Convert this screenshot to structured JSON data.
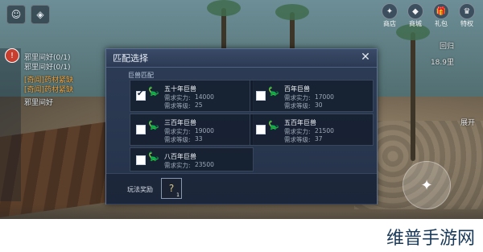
{
  "hud": {
    "top_right": [
      {
        "label": "商店",
        "icon": "shop-icon"
      },
      {
        "label": "商城",
        "icon": "mall-icon"
      },
      {
        "label": "礼包",
        "icon": "gift-icon"
      },
      {
        "label": "特权",
        "icon": "privilege-icon"
      }
    ],
    "left_quests": [
      {
        "text": "邪里间好(0/1)"
      },
      {
        "text": "邪里间好(0/1)"
      },
      {
        "text": "[奇闻]药材紧缺",
        "orange": true
      },
      {
        "text": "[奇闻]药材紧缺",
        "orange": true
      },
      {
        "text": "邪里间好"
      }
    ],
    "right_info": {
      "distance": "18.9里",
      "expand": "展开",
      "back": "回归"
    }
  },
  "dialog": {
    "title": "匹配选择",
    "section": "巨兽匹配",
    "options": [
      {
        "name": "五十年巨兽",
        "power_label": "需求实力:",
        "power": "14000",
        "level_label": "需求等级:",
        "level": "25",
        "checked": true
      },
      {
        "name": "百年巨兽",
        "power_label": "需求实力:",
        "power": "17000",
        "level_label": "需求等级:",
        "level": "30",
        "checked": false
      },
      {
        "name": "三百年巨兽",
        "power_label": "需求实力:",
        "power": "19000",
        "level_label": "需求等级:",
        "level": "33",
        "checked": false
      },
      {
        "name": "五百年巨兽",
        "power_label": "需求实力:",
        "power": "21500",
        "level_label": "需求等级:",
        "level": "37",
        "checked": false
      },
      {
        "name": "八百年巨兽",
        "power_label": "需求实力:",
        "power": "23500",
        "level_label": "",
        "level": "",
        "checked": false
      }
    ],
    "reward_label": "玩法奖励",
    "reward_item": {
      "icon": "question-item-icon",
      "count": "1"
    }
  },
  "watermark": "维普手游网"
}
